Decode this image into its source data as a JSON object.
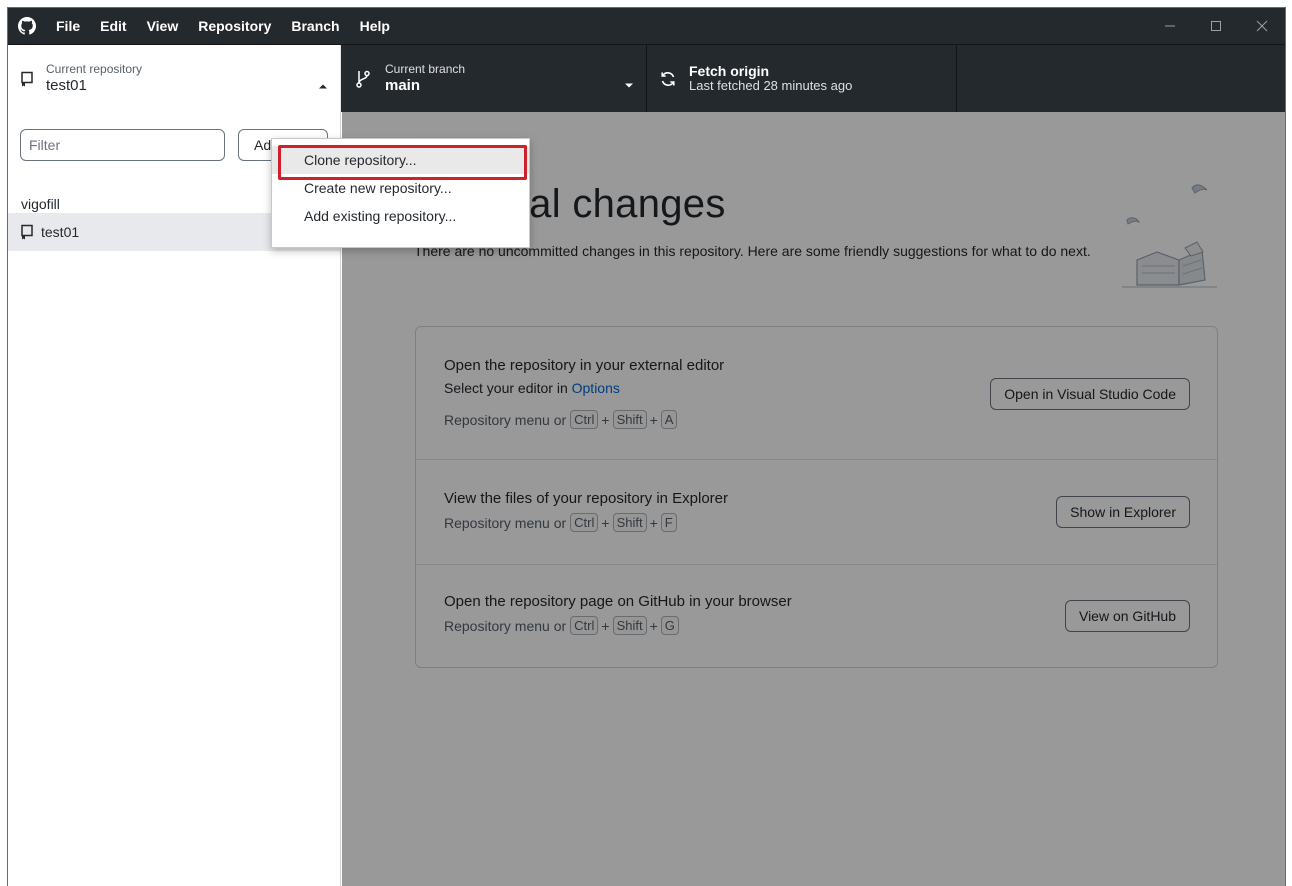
{
  "menu": {
    "items": [
      "File",
      "Edit",
      "View",
      "Repository",
      "Branch",
      "Help"
    ]
  },
  "toolbar": {
    "repo_label": "Current repository",
    "repo_value": "test01",
    "branch_label": "Current branch",
    "branch_value": "main",
    "fetch_label": "Fetch origin",
    "fetch_sub": "Last fetched 28 minutes ago"
  },
  "sidebar": {
    "filter_placeholder": "Filter",
    "add_label": "Add",
    "group_title": "vigofill",
    "repo_name": "test01"
  },
  "dropdown": {
    "items": [
      "Clone repository...",
      "Create new repository...",
      "Add existing repository..."
    ]
  },
  "main": {
    "title": "No local changes",
    "description": "There are no uncommitted changes in this repository. Here are some friendly suggestions for what to do next.",
    "suggestions": [
      {
        "title": "Open the repository in your external editor",
        "sub_prefix": "Select your editor in ",
        "sub_link": "Options",
        "hint_prefix": "Repository menu or",
        "keys": [
          "Ctrl",
          "Shift",
          "A"
        ],
        "button": "Open in Visual Studio Code"
      },
      {
        "title": "View the files of your repository in Explorer",
        "hint_prefix": "Repository menu or",
        "keys": [
          "Ctrl",
          "Shift",
          "F"
        ],
        "button": "Show in Explorer"
      },
      {
        "title": "Open the repository page on GitHub in your browser",
        "hint_prefix": "Repository menu or",
        "keys": [
          "Ctrl",
          "Shift",
          "G"
        ],
        "button": "View on GitHub"
      }
    ]
  },
  "colors": {
    "titlebar_bg": "#24292e",
    "highlight_border": "#d0212a",
    "link": "#0366d6"
  }
}
